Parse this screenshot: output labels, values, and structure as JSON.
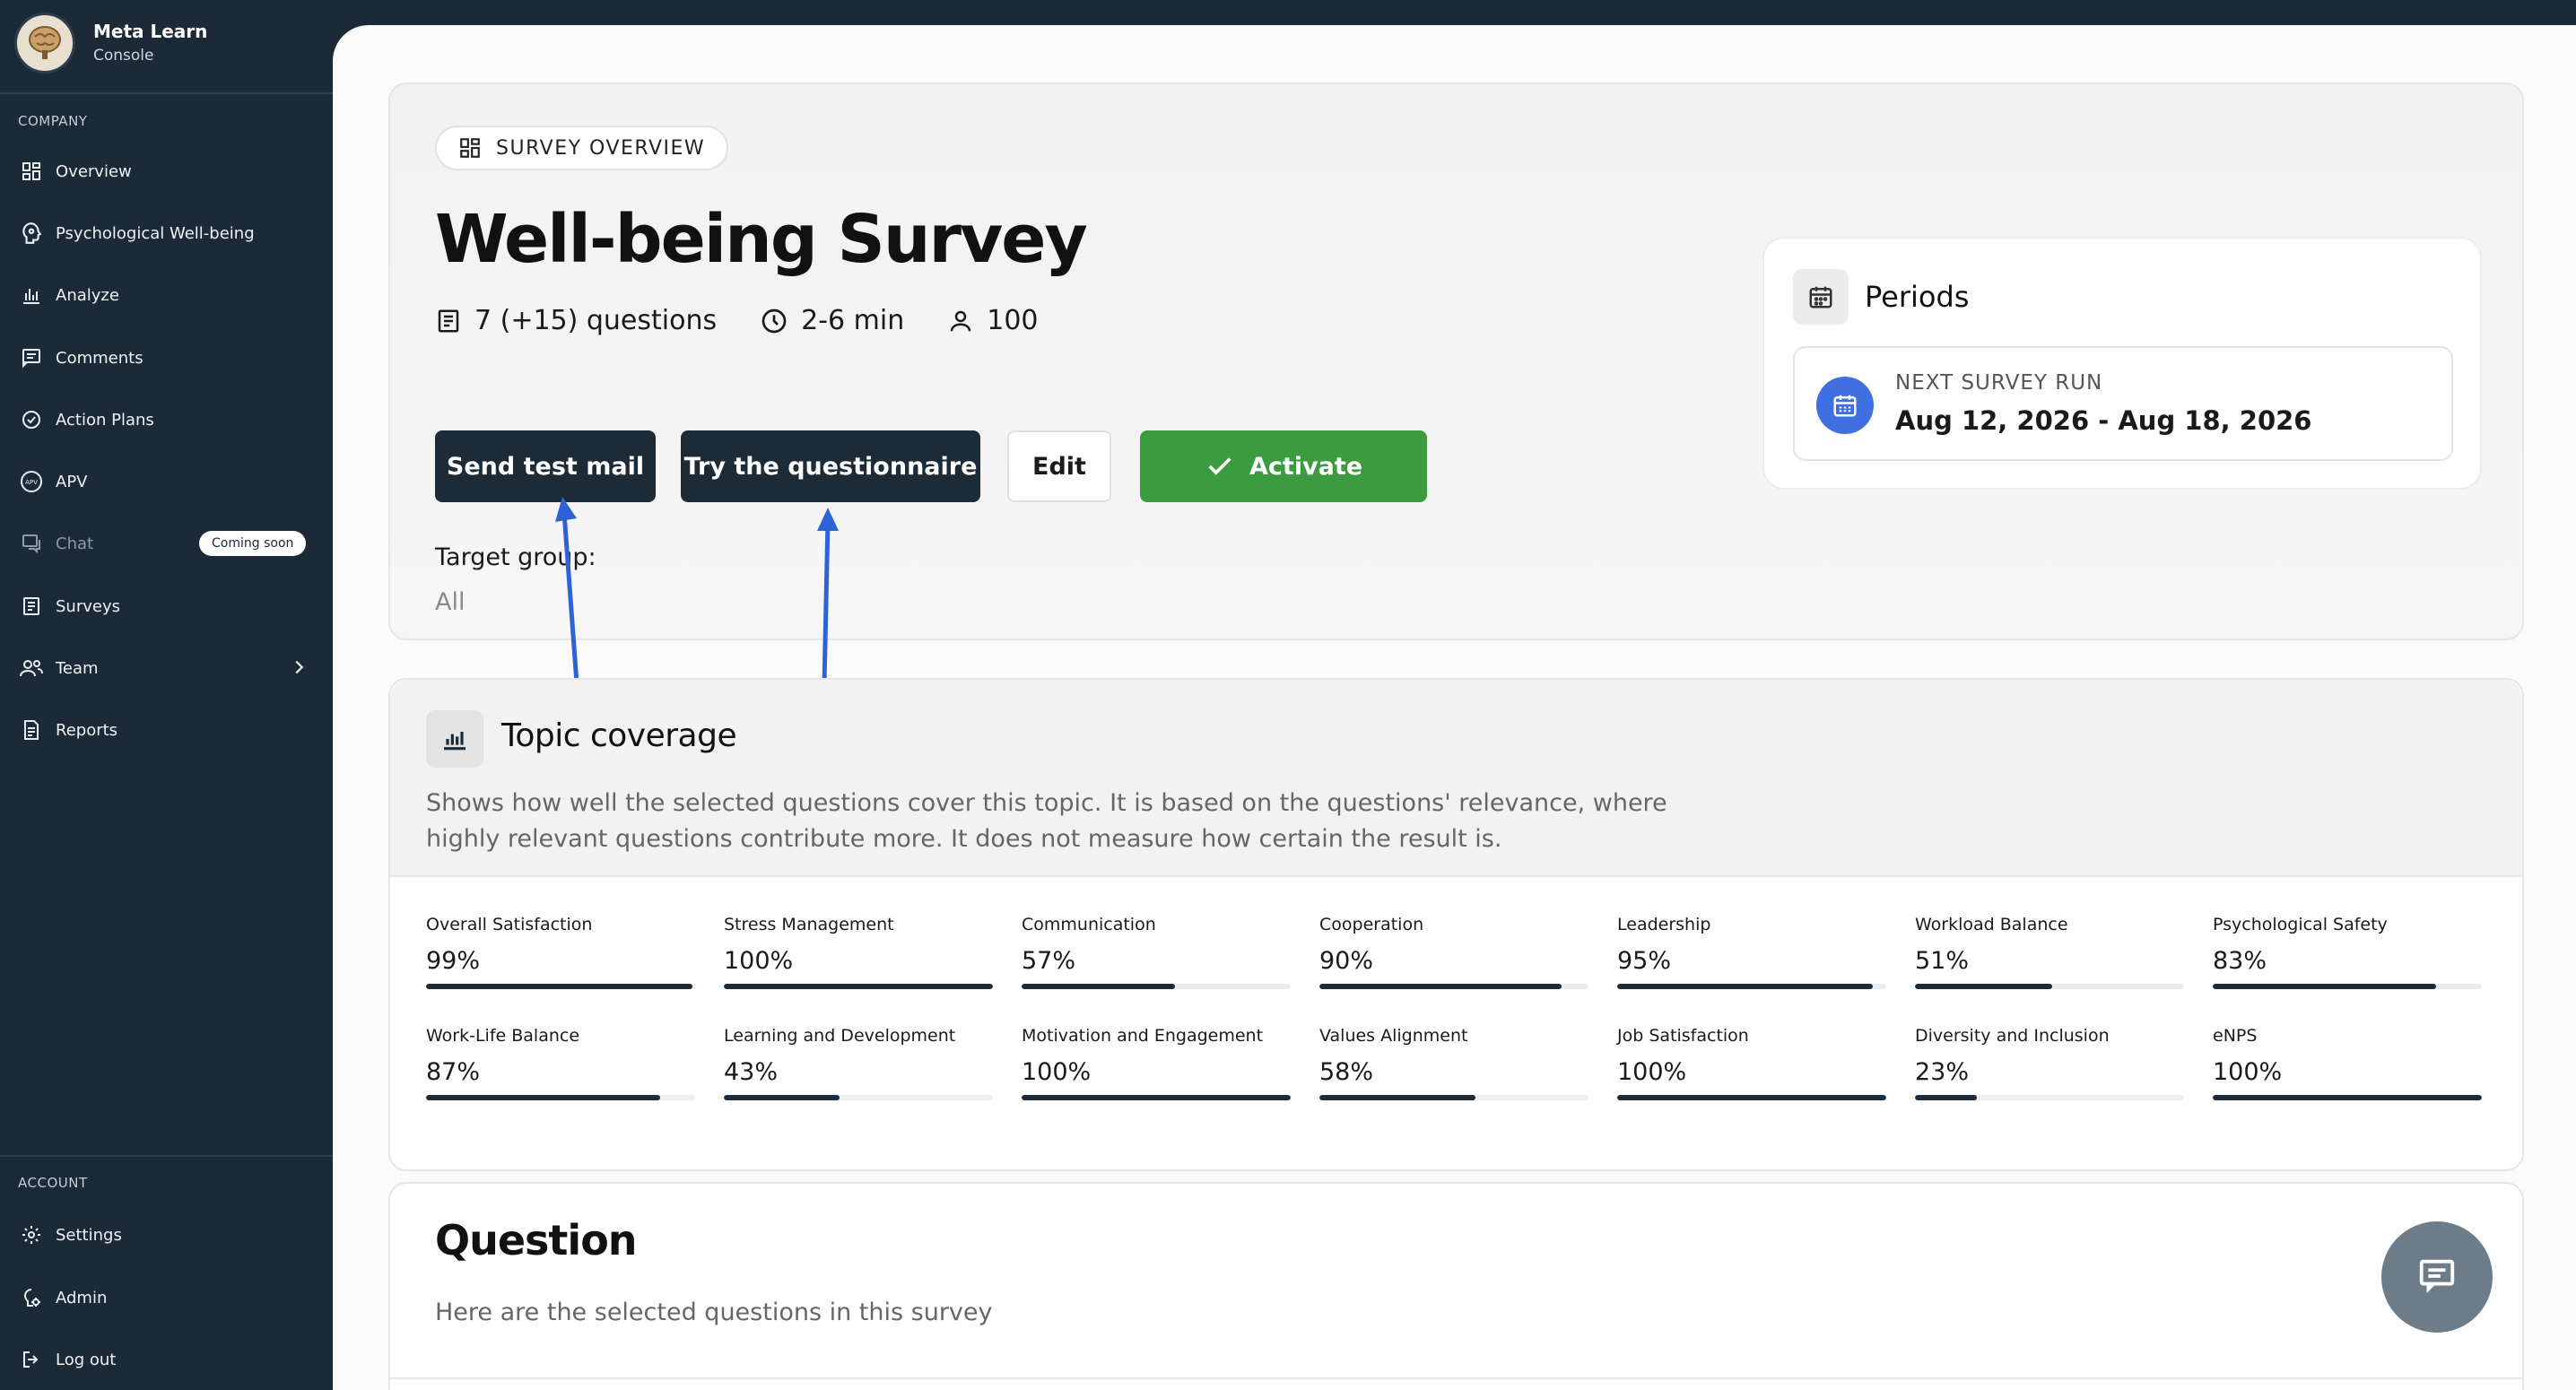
{
  "brand": {
    "name": "Meta Learn",
    "subtitle": "Console"
  },
  "sidebar": {
    "company_label": "COMPANY",
    "items": [
      {
        "label": "Overview",
        "icon": "grid-icon"
      },
      {
        "label": "Psychological Well-being",
        "icon": "head-icon"
      },
      {
        "label": "Analyze",
        "icon": "bar-chart-icon"
      },
      {
        "label": "Comments",
        "icon": "comment-icon"
      },
      {
        "label": "Action Plans",
        "icon": "check-circle-icon"
      },
      {
        "label": "APV",
        "icon": "apv-icon"
      },
      {
        "label": "Chat",
        "icon": "chat-icon",
        "badge": "Coming soon"
      },
      {
        "label": "Surveys",
        "icon": "clipboard-icon"
      },
      {
        "label": "Team",
        "icon": "team-icon"
      },
      {
        "label": "Reports",
        "icon": "report-icon"
      }
    ],
    "account_label": "ACCOUNT",
    "account_items": [
      {
        "label": "Settings",
        "icon": "gear-icon"
      },
      {
        "label": "Admin",
        "icon": "admin-icon"
      },
      {
        "label": "Log out",
        "icon": "logout-icon"
      }
    ]
  },
  "survey": {
    "pill": "SURVEY OVERVIEW",
    "title": "Well-being Survey",
    "questions": "7 (+15) questions",
    "duration": "2-6 min",
    "participants": "100",
    "buttons": {
      "send_test": "Send test mail",
      "try": "Try the questionnaire",
      "edit": "Edit",
      "activate": "Activate"
    },
    "target_label": "Target group:",
    "target_value": "All"
  },
  "periods": {
    "title": "Periods",
    "next_label": "NEXT SURVEY RUN",
    "next_dates": "Aug 12, 2026 - Aug 18, 2026"
  },
  "topics": {
    "title": "Topic coverage",
    "description": "Shows how well the selected questions cover this topic. It is based on the questions' relevance, where highly relevant questions contribute more. It does not measure how certain the result is.",
    "metrics": [
      {
        "name": "Overall Satisfaction",
        "value": "99%",
        "fill": 0.99
      },
      {
        "name": "Stress Management",
        "value": "100%",
        "fill": 1.0
      },
      {
        "name": "Communication",
        "value": "57%",
        "fill": 0.57
      },
      {
        "name": "Cooperation",
        "value": "90%",
        "fill": 0.9
      },
      {
        "name": "Leadership",
        "value": "95%",
        "fill": 0.95
      },
      {
        "name": "Workload Balance",
        "value": "51%",
        "fill": 0.51
      },
      {
        "name": "Psychological Safety",
        "value": "83%",
        "fill": 0.83
      },
      {
        "name": "Work-Life Balance",
        "value": "87%",
        "fill": 0.87
      },
      {
        "name": "Learning and Development",
        "value": "43%",
        "fill": 0.43
      },
      {
        "name": "Motivation and Engagement",
        "value": "100%",
        "fill": 1.0
      },
      {
        "name": "Values Alignment",
        "value": "58%",
        "fill": 0.58
      },
      {
        "name": "Job Satisfaction",
        "value": "100%",
        "fill": 1.0
      },
      {
        "name": "Diversity and Inclusion",
        "value": "23%",
        "fill": 0.23
      },
      {
        "name": "eNPS",
        "value": "100%",
        "fill": 1.0
      }
    ]
  },
  "question": {
    "title": "Question",
    "subtitle": "Here are the selected questions in this survey"
  },
  "colors": {
    "sidebar": "#1b2a36",
    "primary": "#1d2b37",
    "success": "#3b9b3f",
    "accent": "#3f6fe0"
  }
}
